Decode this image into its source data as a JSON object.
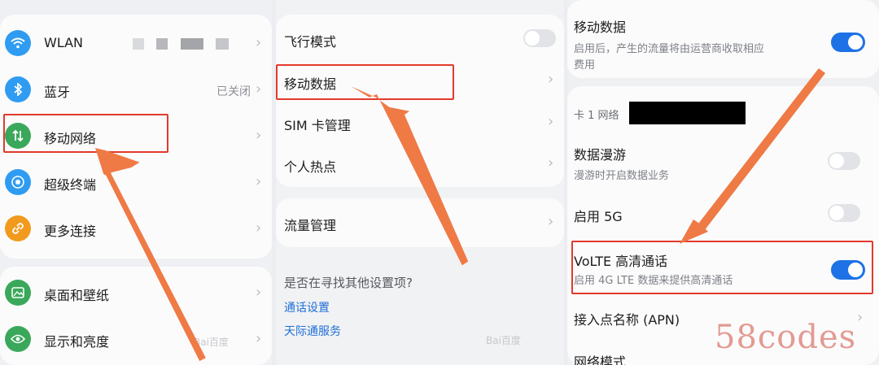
{
  "colors": {
    "accent_blue": "#1e72e6",
    "highlight_red": "#e23a2c",
    "arrow_orange": "#ef7a45",
    "wlan_icon": "#2f9cf2",
    "bluetooth_icon": "#2f9cf2",
    "mobile_icon": "#3aa85a",
    "super_device_icon": "#2f9cf2",
    "more_connections_icon": "#f29a1e",
    "wallpaper_icon": "#3aa85a",
    "display_icon": "#3aa85a"
  },
  "panel1": {
    "items": [
      {
        "label": "WLAN",
        "icon": "wifi-icon",
        "value": ""
      },
      {
        "label": "蓝牙",
        "icon": "bluetooth-icon",
        "value": "已关闭"
      },
      {
        "label": "移动网络",
        "icon": "mobile-network-icon",
        "value": ""
      },
      {
        "label": "超级终端",
        "icon": "super-device-icon",
        "value": ""
      },
      {
        "label": "更多连接",
        "icon": "link-icon",
        "value": ""
      }
    ],
    "items2": [
      {
        "label": "桌面和壁纸",
        "icon": "wallpaper-icon"
      },
      {
        "label": "显示和亮度",
        "icon": "eye-icon"
      }
    ],
    "watermark": "Bai百度"
  },
  "panel2": {
    "items": [
      {
        "label": "飞行模式"
      },
      {
        "label": "移动数据"
      },
      {
        "label": "SIM 卡管理"
      },
      {
        "label": "个人热点"
      }
    ],
    "traffic": {
      "label": "流量管理"
    },
    "search": {
      "question": "是否在寻找其他设置项?",
      "links": [
        "通话设置",
        "天际通服务"
      ]
    },
    "watermark": "Bai百度"
  },
  "panel3": {
    "mobile_data": {
      "title": "移动数据",
      "sub1": "启用后，产生的流量将由运营商收取相应",
      "sub2": "费用"
    },
    "card_network": {
      "title": "卡 1 网络"
    },
    "roaming": {
      "title": "数据漫游",
      "sub": "漫游时开启数据业务"
    },
    "enable_5g": {
      "title": "启用 5G"
    },
    "volte": {
      "title": "VoLTE 高清通话",
      "sub": "启用 4G LTE 数据来提供高清通话"
    },
    "apn": {
      "title": "接入点名称 (APN)"
    },
    "network_mode": {
      "title": "网络模式"
    },
    "brand": "58codes"
  }
}
